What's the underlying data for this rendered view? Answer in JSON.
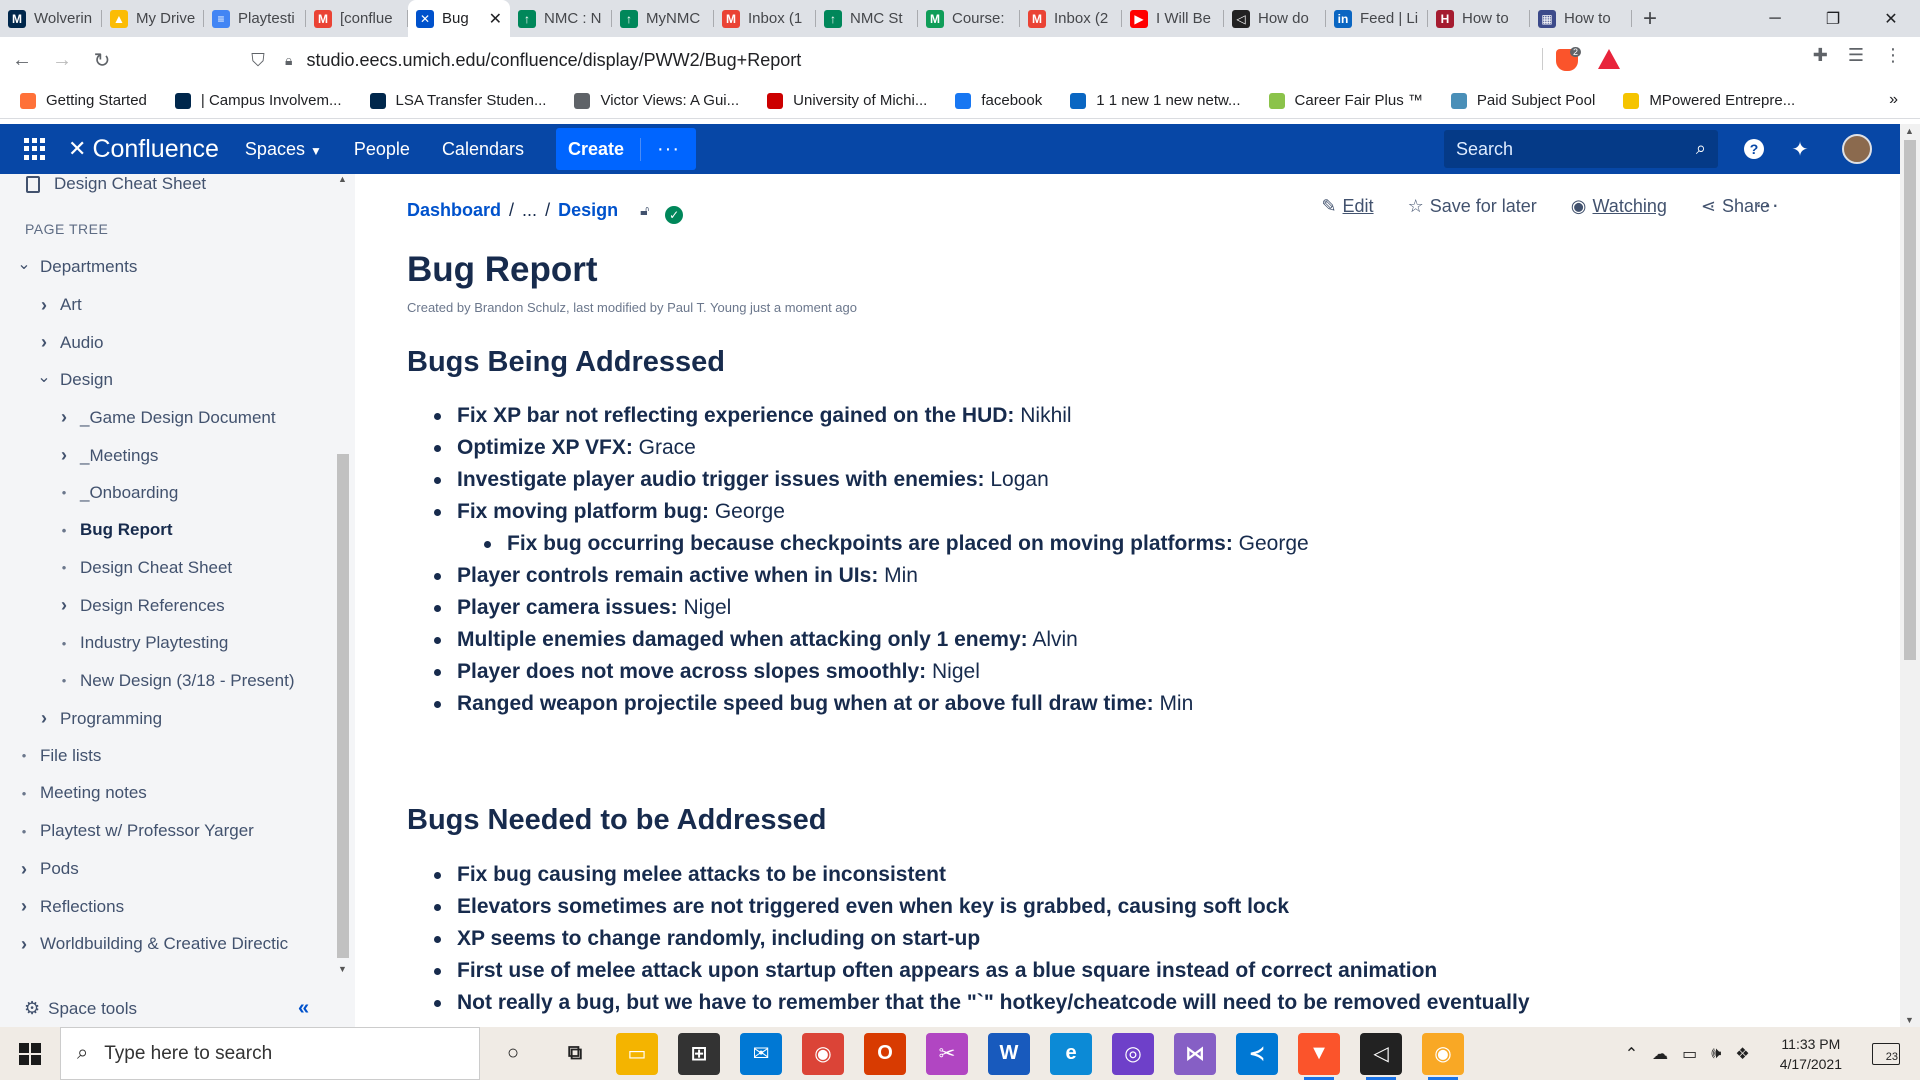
{
  "browser": {
    "tabs": [
      {
        "label": "Wolverin",
        "icon": "michigan-m-icon",
        "color": "#00274c",
        "glyph": "M",
        "active": false
      },
      {
        "label": "My Drive",
        "icon": "google-drive-icon",
        "color": "#fbbc04",
        "glyph": "▲",
        "active": false
      },
      {
        "label": "Playtesti",
        "icon": "google-docs-icon",
        "color": "#4285f4",
        "glyph": "≡",
        "active": false
      },
      {
        "label": "[conflue",
        "icon": "gmail-icon",
        "color": "#ea4335",
        "glyph": "M",
        "active": false
      },
      {
        "label": "Bug",
        "icon": "confluence-icon",
        "color": "#0052cc",
        "glyph": "✕",
        "active": true
      },
      {
        "label": "NMC : N",
        "icon": "nmc-icon",
        "color": "#00875a",
        "glyph": "↑",
        "active": false
      },
      {
        "label": "MyNMC",
        "icon": "nmc-icon",
        "color": "#00875a",
        "glyph": "↑",
        "active": false
      },
      {
        "label": "Inbox (1",
        "icon": "gmail-icon",
        "color": "#ea4335",
        "glyph": "M",
        "active": false
      },
      {
        "label": "NMC St",
        "icon": "nmc-icon",
        "color": "#00875a",
        "glyph": "↑",
        "active": false
      },
      {
        "label": "Course:",
        "icon": "course-m-icon",
        "color": "#0f9d58",
        "glyph": "M",
        "active": false
      },
      {
        "label": "Inbox (2",
        "icon": "gmail-icon",
        "color": "#ea4335",
        "glyph": "M",
        "active": false
      },
      {
        "label": "I Will Be",
        "icon": "youtube-icon",
        "color": "#ff0000",
        "glyph": "▶",
        "active": false
      },
      {
        "label": "How do",
        "icon": "unity-icon",
        "color": "#222222",
        "glyph": "◁",
        "active": false
      },
      {
        "label": "Feed | Li",
        "icon": "linkedin-icon",
        "color": "#0a66c2",
        "glyph": "in",
        "active": false
      },
      {
        "label": "How to",
        "icon": "harvard-h-icon",
        "color": "#a51c30",
        "glyph": "H",
        "active": false
      },
      {
        "label": "How to",
        "icon": "calendar-grid-icon",
        "color": "#3c4a8a",
        "glyph": "▦",
        "active": false
      }
    ],
    "url": "studio.eecs.umich.edu/confluence/display/PWW2/Bug+Report",
    "shield_count": "2",
    "bookmarks": [
      {
        "label": "Getting Started",
        "icon": "firefox-icon",
        "color": "#ff7139"
      },
      {
        "label": "| Campus Involvem...",
        "icon": "michigan-m-icon",
        "color": "#00274c"
      },
      {
        "label": "LSA Transfer Studen...",
        "icon": "umich-logo-icon",
        "color": "#00274c"
      },
      {
        "label": "Victor Views: A Gui...",
        "icon": "globe-icon",
        "color": "#5f6368"
      },
      {
        "label": "University of Michi...",
        "icon": "sd-icon",
        "color": "#cc0000"
      },
      {
        "label": "facebook",
        "icon": "facebook-icon",
        "color": "#1877f2"
      },
      {
        "label": "1 1 new 1 new netw...",
        "icon": "linkedin-icon",
        "color": "#0a66c2"
      },
      {
        "label": "Career Fair Plus ™",
        "icon": "careerfair-icon",
        "color": "#8bc34a"
      },
      {
        "label": "Paid Subject Pool",
        "icon": "umich-pool-icon",
        "color": "#4a8fb8"
      },
      {
        "label": "MPowered Entrepre...",
        "icon": "hexagon-icon",
        "color": "#f5c400"
      }
    ]
  },
  "confluence": {
    "logo_text": "Confluence",
    "nav": [
      "Spaces",
      "People",
      "Calendars"
    ],
    "create_label": "Create",
    "search_placeholder": "Search"
  },
  "sidebar": {
    "top_item": "Design Cheat Sheet",
    "heading": "PAGE TREE",
    "tree": [
      {
        "label": "Departments",
        "marker": "expanded",
        "level": 0
      },
      {
        "label": "Art",
        "marker": "collapsed",
        "level": 1
      },
      {
        "label": "Audio",
        "marker": "collapsed",
        "level": 1
      },
      {
        "label": "Design",
        "marker": "expanded",
        "level": 1
      },
      {
        "label": "_Game Design Document",
        "marker": "collapsed",
        "level": 2
      },
      {
        "label": "_Meetings",
        "marker": "collapsed",
        "level": 2
      },
      {
        "label": "_Onboarding",
        "marker": "bullet",
        "level": 2
      },
      {
        "label": "Bug Report",
        "marker": "bullet",
        "level": 2,
        "current": true
      },
      {
        "label": "Design Cheat Sheet",
        "marker": "bullet",
        "level": 2
      },
      {
        "label": "Design References",
        "marker": "collapsed",
        "level": 2
      },
      {
        "label": "Industry Playtesting",
        "marker": "bullet",
        "level": 2
      },
      {
        "label": "New Design (3/18 - Present)",
        "marker": "bullet",
        "level": 2
      },
      {
        "label": "Programming",
        "marker": "collapsed",
        "level": 1
      },
      {
        "label": "File lists",
        "marker": "bullet",
        "level": 0
      },
      {
        "label": "Meeting notes",
        "marker": "bullet",
        "level": 0
      },
      {
        "label": "Playtest w/ Professor Yarger",
        "marker": "bullet",
        "level": 0
      },
      {
        "label": "Pods",
        "marker": "collapsed",
        "level": 0
      },
      {
        "label": "Reflections",
        "marker": "collapsed",
        "level": 0
      },
      {
        "label": "Worldbuilding & Creative Directic",
        "marker": "collapsed",
        "level": 0
      }
    ],
    "space_tools": "Space tools"
  },
  "page": {
    "breadcrumb": {
      "root": "Dashboard",
      "sep1": "/",
      "ellipsis": "...",
      "sep2": "/",
      "parent": "Design"
    },
    "actions": {
      "edit": "Edit",
      "save": "Save for later",
      "watch": "Watching",
      "share": "Share"
    },
    "title": "Bug Report",
    "meta": "Created by Brandon Schulz, last modified by Paul T. Young just a moment ago",
    "section1": {
      "heading": "Bugs Being Addressed",
      "items": [
        {
          "bold": "Fix XP bar not reflecting experience gained on the HUD:",
          "owner": " Nikhil",
          "sub": false
        },
        {
          "bold": "Optimize XP VFX:",
          "owner": " Grace",
          "sub": false
        },
        {
          "bold": "Investigate player audio trigger issues with enemies:",
          "owner": " Logan",
          "sub": false
        },
        {
          "bold": "Fix moving platform bug:",
          "owner": " George",
          "sub": false
        },
        {
          "bold": "Fix bug occurring because checkpoints are placed on moving platforms:",
          "owner": " George",
          "sub": true
        },
        {
          "bold": "Player controls remain active when in UIs:",
          "owner": " Min",
          "sub": false
        },
        {
          "bold": "Player camera issues:",
          "owner": " Nigel",
          "sub": false
        },
        {
          "bold": "Multiple enemies damaged when attacking only 1 enemy:",
          "owner": " Alvin",
          "sub": false
        },
        {
          "bold": "Player does not move across slopes smoothly:",
          "owner": " Nigel",
          "sub": false
        },
        {
          "bold": "Ranged weapon projectile speed bug when at or above full draw time:",
          "owner": " Min",
          "sub": false
        }
      ]
    },
    "section2": {
      "heading": "Bugs Needed to be Addressed",
      "items": [
        {
          "bold": "Fix bug causing melee attacks to be inconsistent",
          "owner": "",
          "sub": false
        },
        {
          "bold": "Elevators sometimes are not triggered even when key is grabbed, causing soft lock",
          "owner": "",
          "sub": false
        },
        {
          "bold": "XP seems to change randomly, including on start-up",
          "owner": "",
          "sub": false
        },
        {
          "bold": "First use of melee attack upon startup often appears as a blue square instead of correct animation",
          "owner": "",
          "sub": false
        },
        {
          "bold": "Not really a bug, but we have to remember that the \"`\" hotkey/cheatcode will need to be removed eventually",
          "owner": "",
          "sub": false
        }
      ]
    }
  },
  "taskbar": {
    "search_placeholder": "Type here to search",
    "apps": [
      {
        "name": "cortana-icon",
        "color": "#f0ebe5",
        "glyph": "○",
        "fg": "#222",
        "run": false
      },
      {
        "name": "task-view-icon",
        "color": "#f0ebe5",
        "glyph": "⧉",
        "fg": "#222",
        "run": false
      },
      {
        "name": "file-explorer-icon",
        "color": "#f4b400",
        "glyph": "▭",
        "fg": "#fff",
        "run": false
      },
      {
        "name": "store-icon",
        "color": "#333333",
        "glyph": "⊞",
        "fg": "#fff",
        "run": false
      },
      {
        "name": "mail-icon",
        "color": "#0078d4",
        "glyph": "✉",
        "fg": "#fff",
        "run": false
      },
      {
        "name": "chrome-icon",
        "color": "#db4437",
        "glyph": "◉",
        "fg": "#fff",
        "run": false
      },
      {
        "name": "office-icon",
        "color": "#d83b01",
        "glyph": "O",
        "fg": "#fff",
        "run": false
      },
      {
        "name": "snip-icon",
        "color": "#b146c2",
        "glyph": "✂",
        "fg": "#fff",
        "run": false
      },
      {
        "name": "word-icon",
        "color": "#185abd",
        "glyph": "W",
        "fg": "#fff",
        "run": false
      },
      {
        "name": "edge-icon",
        "color": "#0c8ad6",
        "glyph": "e",
        "fg": "#fff",
        "run": false
      },
      {
        "name": "github-desktop-icon",
        "color": "#6e40c9",
        "glyph": "◎",
        "fg": "#fff",
        "run": false
      },
      {
        "name": "visual-studio-icon",
        "color": "#865fc5",
        "glyph": "⋈",
        "fg": "#fff",
        "run": false
      },
      {
        "name": "vscode-icon",
        "color": "#0078d4",
        "glyph": "≺",
        "fg": "#fff",
        "run": false
      },
      {
        "name": "brave-icon",
        "color": "#fb542b",
        "glyph": "▼",
        "fg": "#fff",
        "run": true
      },
      {
        "name": "unity-icon",
        "color": "#222222",
        "glyph": "◁",
        "fg": "#fff",
        "run": true
      },
      {
        "name": "chrome-canary-icon",
        "color": "#f9a825",
        "glyph": "◉",
        "fg": "#fff",
        "run": true
      }
    ],
    "time": "11:33 PM",
    "date": "4/17/2021",
    "notifications": "23"
  }
}
